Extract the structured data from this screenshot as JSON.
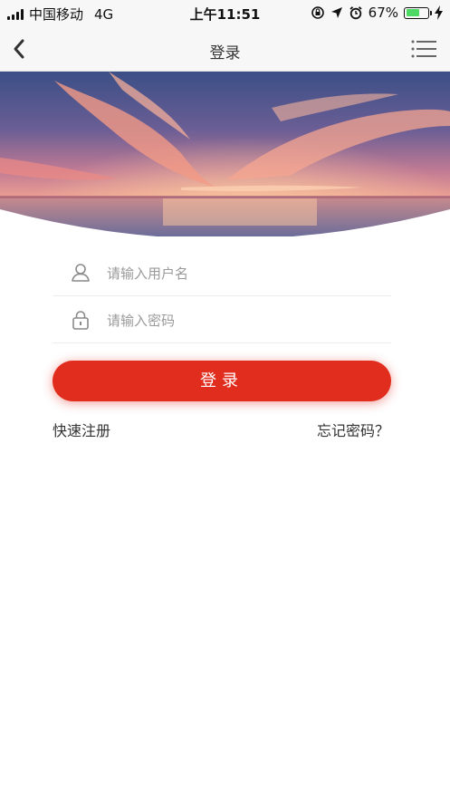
{
  "status_bar": {
    "carrier": "中国移动",
    "network": "4G",
    "time": "上午11:51",
    "battery_percent": "67%",
    "battery_level": 0.67
  },
  "nav": {
    "title": "登录",
    "back_icon": "chevron-left-icon",
    "menu_icon": "menu-icon"
  },
  "login_form": {
    "username_placeholder": "请输入用户名",
    "password_placeholder": "请输入密码",
    "submit_label": "登录",
    "register_link": "快速注册",
    "forgot_link": "忘记密码？"
  },
  "colors": {
    "accent": "#e12d1e",
    "nav_bg": "#f7f7f7",
    "battery": "#4cd964"
  }
}
